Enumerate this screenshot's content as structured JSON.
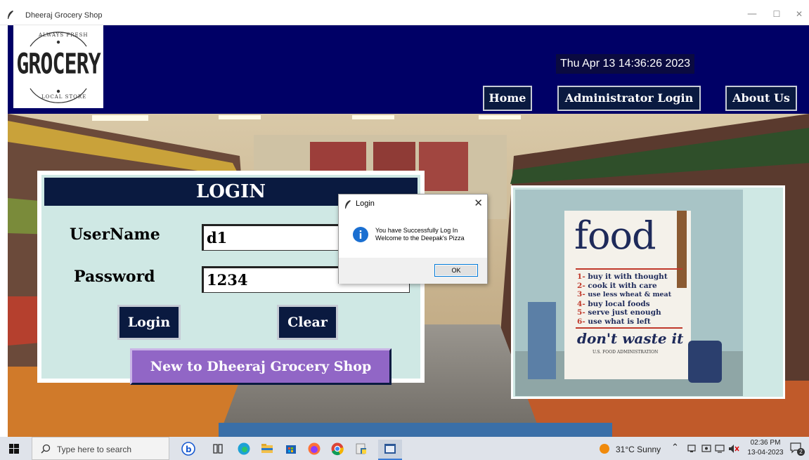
{
  "window": {
    "title": "Dheeraj Grocery Shop",
    "minimize": "—",
    "maximize": "☐",
    "close": "✕"
  },
  "header": {
    "logo": {
      "top_text": "ALWAYS FRESH",
      "main_text": "GROCERY",
      "bottom_text": "LOCAL STORE"
    },
    "datetime": "Thu Apr 13 14:36:26 2023",
    "nav": [
      {
        "label": "Home"
      },
      {
        "label": "Administrator Login"
      },
      {
        "label": "About Us"
      }
    ]
  },
  "login": {
    "heading": "LOGIN",
    "username_label": "UserName",
    "username_value": "d1",
    "password_label": "Password",
    "password_value": "1234",
    "login_button": "Login",
    "clear_button": "Clear",
    "register_button": "New to Dheeraj Grocery Shop"
  },
  "poster": {
    "title": "food",
    "items": [
      {
        "num": "1",
        "text": "buy it with thought"
      },
      {
        "num": "2",
        "text": "cook it with care"
      },
      {
        "num": "3",
        "text": "use less wheat & meat"
      },
      {
        "num": "4",
        "text": "buy local foods"
      },
      {
        "num": "5",
        "text": "serve just enough"
      },
      {
        "num": "6",
        "text": "use what is left"
      }
    ],
    "slogan": "don't waste it",
    "footer": "U.S. FOOD ADMINISTRATION"
  },
  "dialog": {
    "title": "Login",
    "close": "✕",
    "line1": "You have Successfully Log In",
    "line2": "Welcome to the Deepak's Pizza",
    "ok_button": "OK"
  },
  "taskbar": {
    "search_placeholder": "Type here to search",
    "weather": "31°C  Sunny",
    "time": "02:36 PM",
    "date": "13-04-2023",
    "notifications": "2"
  }
}
